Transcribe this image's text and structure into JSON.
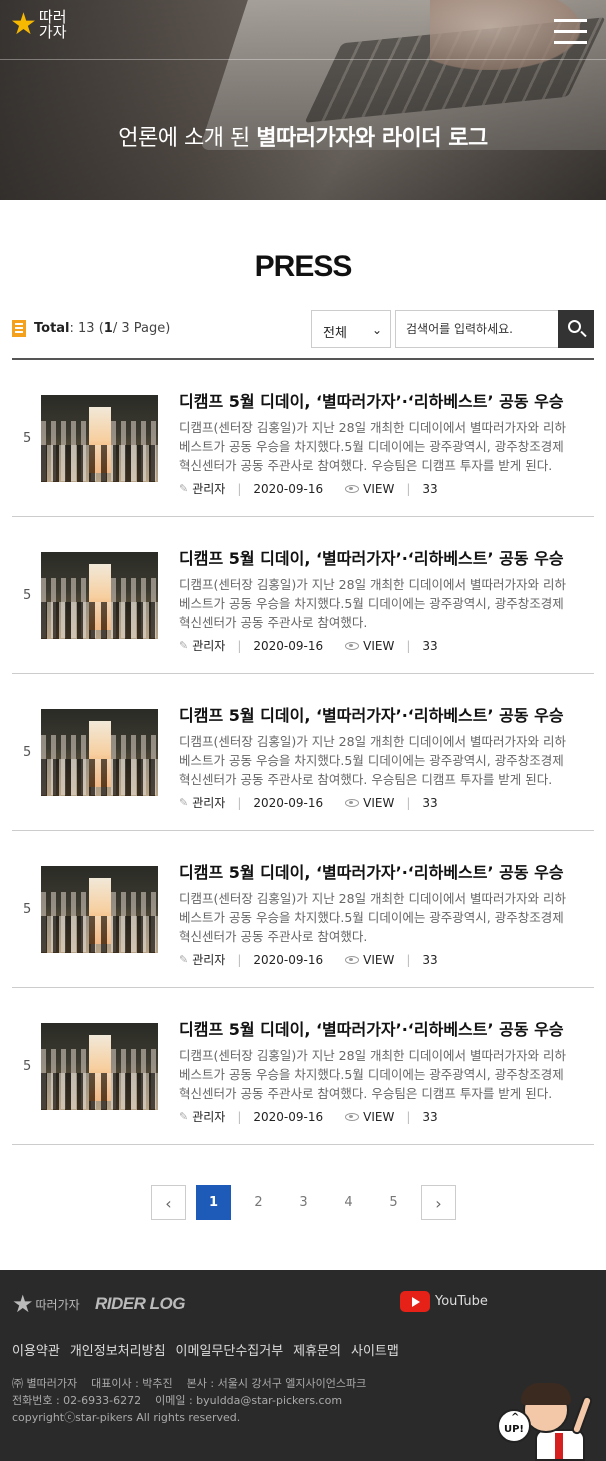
{
  "header": {
    "logo_star": "★",
    "logo_text_line1": "따러",
    "logo_text_line2": "가자",
    "logo_alt": "별따러가자",
    "hero_title_plain": "언론에 소개 된 ",
    "hero_title_bold": "별따러가자와 라이더 로그"
  },
  "page": {
    "title": "PRESS"
  },
  "toolbar": {
    "total_label": "Total",
    "total_text": " : 13 (",
    "current_page": "1",
    "page_text": " / 3 Page)",
    "select_value": "전체",
    "search_placeholder": "검색어를 입력하세요."
  },
  "posts": [
    {
      "num": "5",
      "title": "디캠프 5월 디데이, ‘별따러가자’·‘리하베스트’ 공동 우승",
      "desc": "디캠프(센터장 김홍일)가 지난 28일 개최한 디데이에서 별따러가자와 리하베스트가 공동 우승을 차지했다.5월 디데이에는 광주광역시, 광주창조경제혁신센터가 공동 주관사로 참여했다. 우승팀은 디캠프 투자를 받게 된다.",
      "author": "관리자",
      "date": "2020-09-16",
      "view_label": "VIEW",
      "views": "33"
    },
    {
      "num": "5",
      "title": "디캠프 5월 디데이, ‘별따러가자’·‘리하베스트’ 공동 우승",
      "desc": "디캠프(센터장 김홍일)가 지난 28일 개최한 디데이에서 별따러가자와 리하베스트가 공동 우승을 차지했다.5월 디데이에는 광주광역시, 광주창조경제혁신센터가 공동 주관사로 참여했다.",
      "author": "관리자",
      "date": "2020-09-16",
      "view_label": "VIEW",
      "views": "33"
    },
    {
      "num": "5",
      "title": "디캠프 5월 디데이, ‘별따러가자’·‘리하베스트’ 공동 우승",
      "desc": "디캠프(센터장 김홍일)가 지난 28일 개최한 디데이에서 별따러가자와 리하베스트가 공동 우승을 차지했다.5월 디데이에는 광주광역시, 광주창조경제혁신센터가 공동 주관사로 참여했다. 우승팀은 디캠프 투자를 받게 된다.",
      "author": "관리자",
      "date": "2020-09-16",
      "view_label": "VIEW",
      "views": "33"
    },
    {
      "num": "5",
      "title": "디캠프 5월 디데이, ‘별따러가자’·‘리하베스트’ 공동 우승",
      "desc": "디캠프(센터장 김홍일)가 지난 28일 개최한 디데이에서 별따러가자와 리하베스트가 공동 우승을 차지했다.5월 디데이에는 광주광역시, 광주창조경제혁신센터가 공동 주관사로 참여했다.",
      "author": "관리자",
      "date": "2020-09-16",
      "view_label": "VIEW",
      "views": "33"
    },
    {
      "num": "5",
      "title": "디캠프 5월 디데이, ‘별따러가자’·‘리하베스트’ 공동 우승",
      "desc": "디캠프(센터장 김홍일)가 지난 28일 개최한 디데이에서 별따러가자와 리하베스트가 공동 우승을 차지했다.5월 디데이에는 광주광역시, 광주창조경제혁신센터가 공동 주관사로 참여했다. 우승팀은 디캠프 투자를 받게 된다.",
      "author": "관리자",
      "date": "2020-09-16",
      "view_label": "VIEW",
      "views": "33"
    }
  ],
  "pagination": {
    "prev": "‹",
    "pages": [
      "1",
      "2",
      "3",
      "4",
      "5"
    ],
    "active": "1",
    "next": "›"
  },
  "footer": {
    "logo_text": "따러가자",
    "rider_log": "RIDER LOG",
    "youtube_label": "YouTube",
    "links": [
      "이용약관",
      "개인정보처리방침",
      "이메일무단수집거부",
      "제휴문의",
      "사이트맵"
    ],
    "company": "㈜ 별따러가자",
    "ceo": "대표이사 : 박추진",
    "address": "본사 : 서울시 강서구 엘지사이언스파크",
    "phone": "전화번호 : 02-6933-6272",
    "email": "이메일 : byuldda@star-pickers.com",
    "copyright": "copyrightⓒstar-pikers All rights reserved.",
    "up_label": "UP!"
  },
  "colors": {
    "accent_orange": "#f4a21e",
    "active_page_blue": "#1e5bb8",
    "footer_bg": "#2a2a2a",
    "youtube_red": "#e62117"
  }
}
